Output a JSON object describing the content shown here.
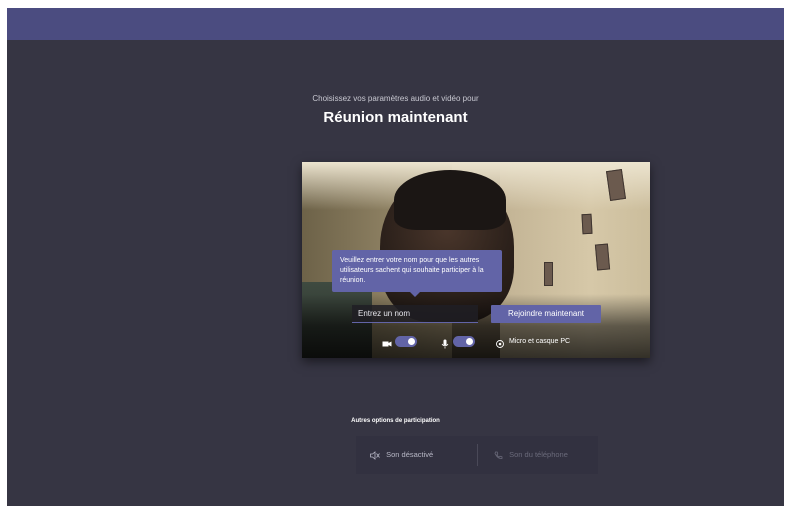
{
  "header": {
    "subtitle": "Choisissez vos paramètres audio et vidéo pour",
    "title": "Réunion maintenant"
  },
  "preview": {
    "tooltip": "Veuillez entrer votre nom pour que les autres utilisateurs sachent qui souhaite participer à la réunion.",
    "name_placeholder": "Entrez un nom",
    "join_label": "Rejoindre maintenant",
    "camera_on": true,
    "mic_on": true,
    "device_label": "Micro et casque PC"
  },
  "other_options": {
    "label": "Autres options de participation",
    "audio_off_label": "Son désactivé",
    "phone_audio_label": "Son du téléphone"
  },
  "colors": {
    "accent": "#6264a7",
    "background": "#363543",
    "topbar": "#4b4c80"
  },
  "icons": [
    "camera-icon",
    "mic-icon",
    "settings-icon",
    "speaker-off-icon",
    "phone-icon"
  ]
}
